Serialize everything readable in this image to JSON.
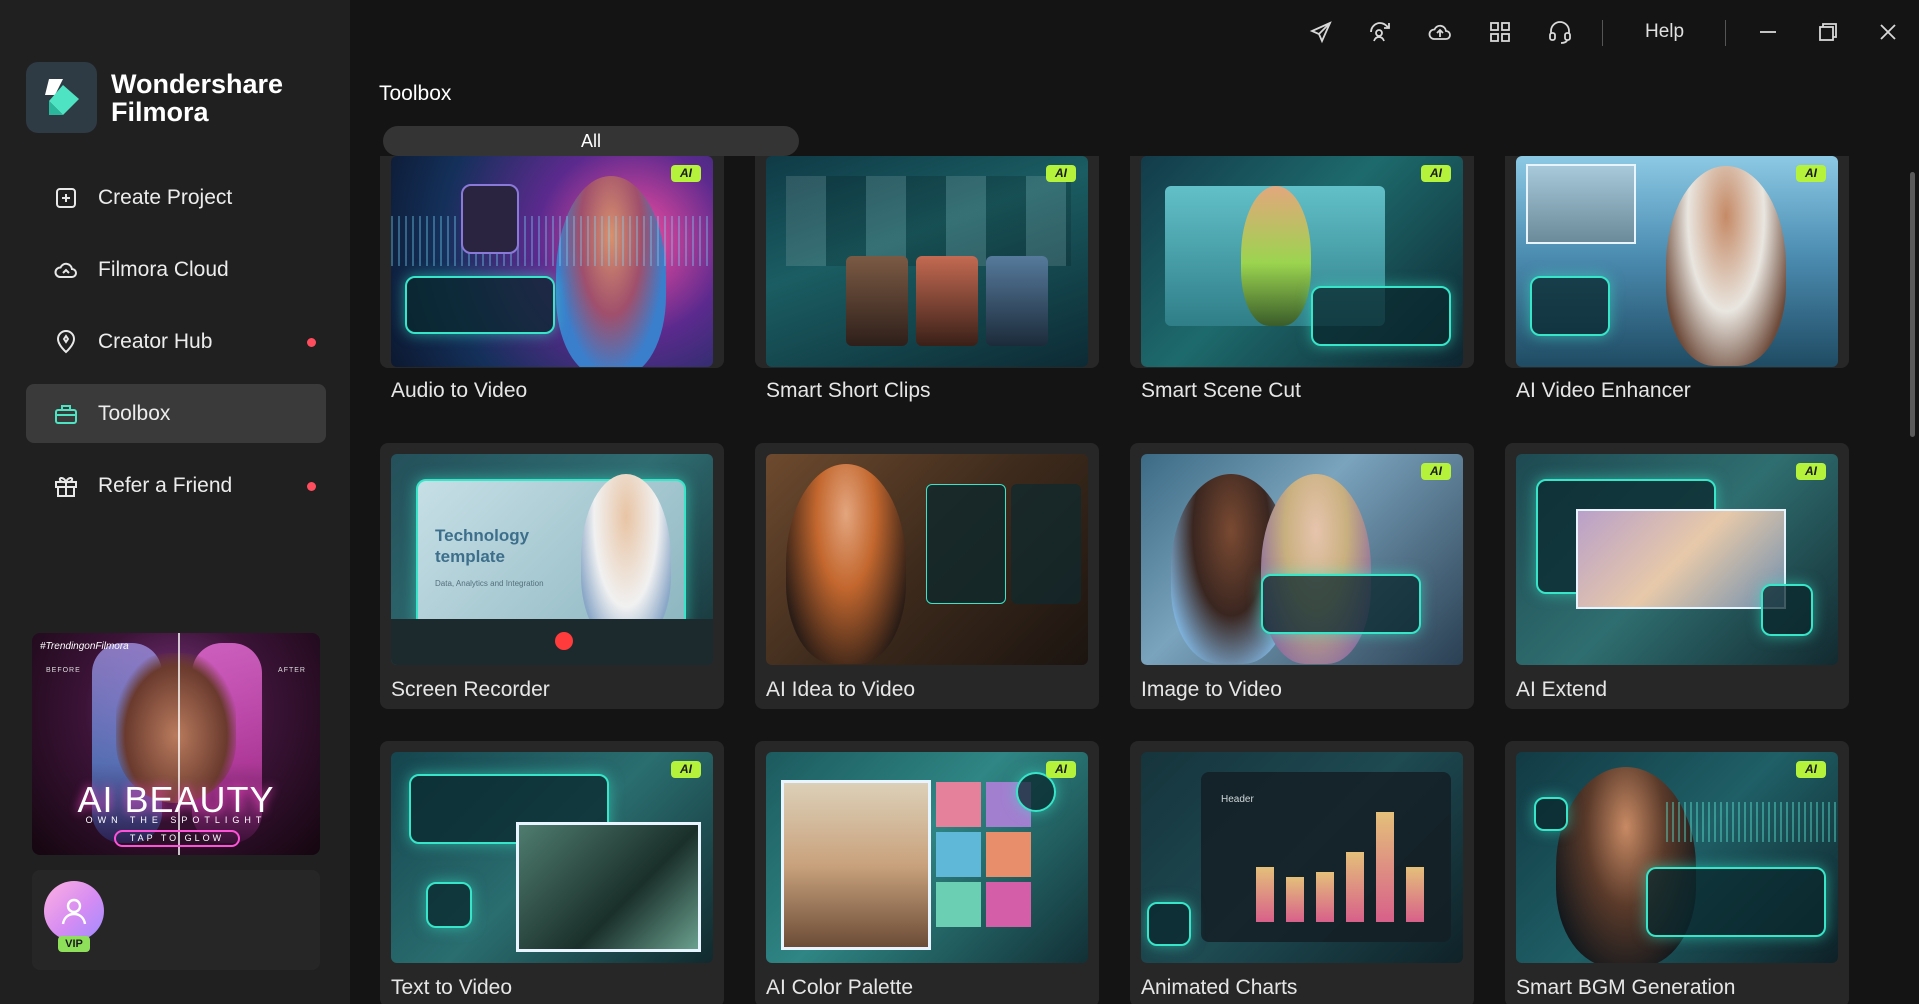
{
  "app": {
    "brand_line1": "Wondershare",
    "brand_line2": "Filmora"
  },
  "sidebar": {
    "items": [
      {
        "label": "Create Project",
        "icon": "plus-square-icon",
        "active": false,
        "dot": false
      },
      {
        "label": "Filmora Cloud",
        "icon": "cloud-icon",
        "active": false,
        "dot": false
      },
      {
        "label": "Creator Hub",
        "icon": "lightbulb-pin-icon",
        "active": false,
        "dot": true
      },
      {
        "label": "Toolbox",
        "icon": "toolbox-icon",
        "active": true,
        "dot": false
      },
      {
        "label": "Refer a Friend",
        "icon": "gift-icon",
        "active": false,
        "dot": true
      }
    ],
    "promo": {
      "hashtag": "#TrendingonFilmora",
      "before": "BEFORE",
      "after": "AFTER",
      "title": "AI BEAUTY",
      "subtitle": "OWN THE SPOTLIGHT",
      "cta": "TAP TO GLOW"
    },
    "user": {
      "badge": "VIP"
    }
  },
  "topbar": {
    "icons": [
      "send-feedback-icon",
      "sync-user-icon",
      "cloud-upload-icon",
      "apps-grid-icon",
      "headset-support-icon"
    ],
    "help_label": "Help",
    "window_controls": [
      "minimize-icon",
      "restore-icon",
      "close-icon"
    ]
  },
  "main": {
    "title": "Toolbox",
    "filter_tabs": [
      "All"
    ],
    "ai_badge": "AI",
    "tools": [
      {
        "label": "Audio to Video",
        "ai": true,
        "theme": "audio"
      },
      {
        "label": "Smart Short Clips",
        "ai": true,
        "theme": "clips"
      },
      {
        "label": "Smart Scene Cut",
        "ai": true,
        "theme": "scene"
      },
      {
        "label": "AI Video Enhancer",
        "ai": true,
        "theme": "enhancer"
      },
      {
        "label": "Screen Recorder",
        "ai": false,
        "theme": "recorder",
        "thumb_text1": "Technology",
        "thumb_text2": "template",
        "thumb_text3": "Data, Analytics and Integration"
      },
      {
        "label": "AI Idea to Video",
        "ai": false,
        "theme": "idea"
      },
      {
        "label": "Image to Video",
        "ai": true,
        "theme": "image"
      },
      {
        "label": "AI Extend",
        "ai": true,
        "theme": "extend"
      },
      {
        "label": "Text to Video",
        "ai": true,
        "theme": "text"
      },
      {
        "label": "AI Color Palette",
        "ai": true,
        "theme": "palette"
      },
      {
        "label": "Animated Charts",
        "ai": false,
        "theme": "charts",
        "thumb_text1": "Header"
      },
      {
        "label": "Smart BGM Generation",
        "ai": true,
        "theme": "bgm"
      }
    ]
  },
  "colors": {
    "accent_teal": "#37e6c8",
    "ai_badge": "#b4f23c",
    "notify_dot": "#ff4d5e",
    "sidebar_bg": "#202020",
    "main_bg": "#141414"
  }
}
